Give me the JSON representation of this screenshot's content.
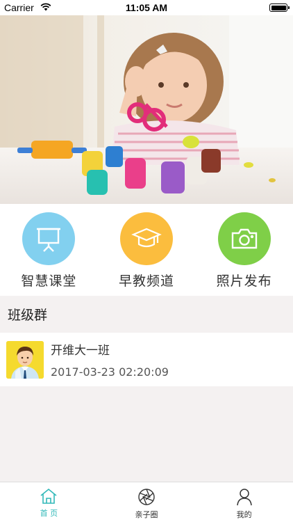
{
  "status_bar": {
    "carrier": "Carrier",
    "time": "11:05 AM",
    "battery": "full"
  },
  "banner": {
    "image": "child-playing-with-playdough-photo"
  },
  "quick_menu": [
    {
      "label": "智慧课堂",
      "icon": "presentation-board-icon",
      "color": "#82d0ef"
    },
    {
      "label": "早教频道",
      "icon": "graduation-cap-icon",
      "color": "#fbbd3e"
    },
    {
      "label": "照片发布",
      "icon": "camera-icon",
      "color": "#7fcf48"
    }
  ],
  "section": {
    "title": "班级群"
  },
  "groups": [
    {
      "name": "开维大一班",
      "time": "2017-03-23 02:20:09",
      "avatar": "teacher-avatar"
    }
  ],
  "tab_bar": [
    {
      "label": "首 页",
      "icon": "home-icon",
      "active": true
    },
    {
      "label": "亲子圈",
      "icon": "aperture-icon",
      "active": false
    },
    {
      "label": "我的",
      "icon": "person-icon",
      "active": false
    }
  ],
  "colors": {
    "accent": "#30b8b8",
    "background": "#f4f1f1"
  }
}
